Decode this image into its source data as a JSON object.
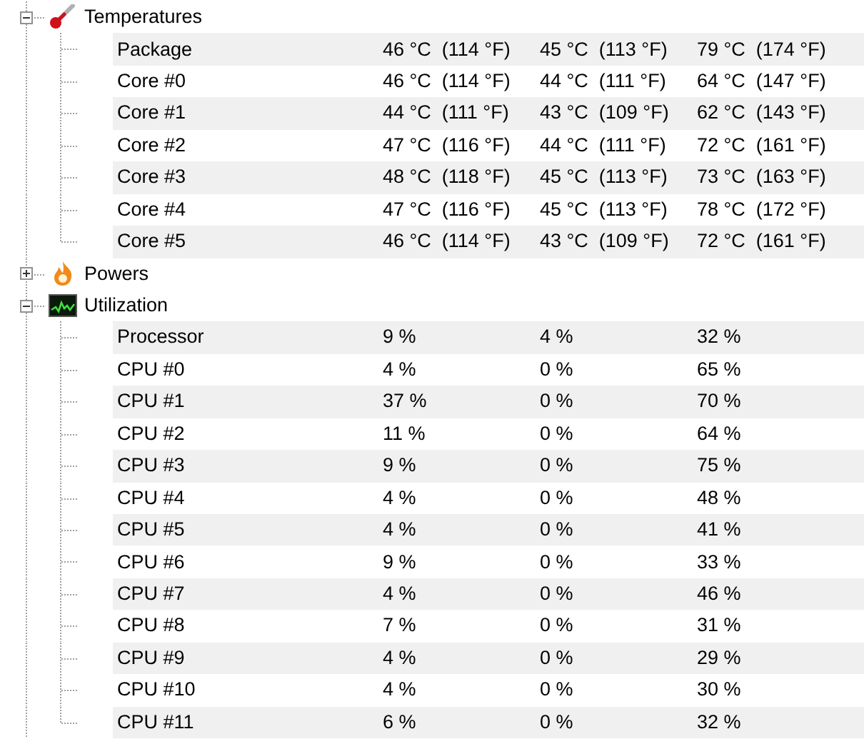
{
  "groups": [
    {
      "label": "Temperatures",
      "kind": "temperature",
      "expanded": true,
      "children": [
        {
          "label": "Package",
          "values": [
            "46 °C  (114 °F)",
            "45 °C  (113 °F)",
            "79 °C  (174 °F)"
          ]
        },
        {
          "label": "Core #0",
          "values": [
            "46 °C  (114 °F)",
            "44 °C  (111 °F)",
            "64 °C  (147 °F)"
          ]
        },
        {
          "label": "Core #1",
          "values": [
            "44 °C  (111 °F)",
            "43 °C  (109 °F)",
            "62 °C  (143 °F)"
          ]
        },
        {
          "label": "Core #2",
          "values": [
            "47 °C  (116 °F)",
            "44 °C  (111 °F)",
            "72 °C  (161 °F)"
          ]
        },
        {
          "label": "Core #3",
          "values": [
            "48 °C  (118 °F)",
            "45 °C  (113 °F)",
            "73 °C  (163 °F)"
          ]
        },
        {
          "label": "Core #4",
          "values": [
            "47 °C  (116 °F)",
            "45 °C  (113 °F)",
            "78 °C  (172 °F)"
          ]
        },
        {
          "label": "Core #5",
          "values": [
            "46 °C  (114 °F)",
            "43 °C  (109 °F)",
            "72 °C  (161 °F)"
          ]
        }
      ]
    },
    {
      "label": "Powers",
      "kind": "power",
      "expanded": false
    },
    {
      "label": "Utilization",
      "kind": "load",
      "expanded": true,
      "children": [
        {
          "label": "Processor",
          "values": [
            "9 %",
            "4 %",
            "32 %"
          ]
        },
        {
          "label": "CPU #0",
          "values": [
            "4 %",
            "0 %",
            "65 %"
          ]
        },
        {
          "label": "CPU #1",
          "values": [
            "37 %",
            "0 %",
            "70 %"
          ]
        },
        {
          "label": "CPU #2",
          "values": [
            "11 %",
            "0 %",
            "64 %"
          ]
        },
        {
          "label": "CPU #3",
          "values": [
            "9 %",
            "0 %",
            "75 %"
          ]
        },
        {
          "label": "CPU #4",
          "values": [
            "4 %",
            "0 %",
            "48 %"
          ]
        },
        {
          "label": "CPU #5",
          "values": [
            "4 %",
            "0 %",
            "41 %"
          ]
        },
        {
          "label": "CPU #6",
          "values": [
            "9 %",
            "0 %",
            "33 %"
          ]
        },
        {
          "label": "CPU #7",
          "values": [
            "4 %",
            "0 %",
            "46 %"
          ]
        },
        {
          "label": "CPU #8",
          "values": [
            "7 %",
            "0 %",
            "31 %"
          ]
        },
        {
          "label": "CPU #9",
          "values": [
            "4 %",
            "0 %",
            "29 %"
          ]
        },
        {
          "label": "CPU #10",
          "values": [
            "4 %",
            "0 %",
            "30 %"
          ]
        },
        {
          "label": "CPU #11",
          "values": [
            "6 %",
            "0 %",
            "32 %"
          ]
        }
      ]
    }
  ]
}
